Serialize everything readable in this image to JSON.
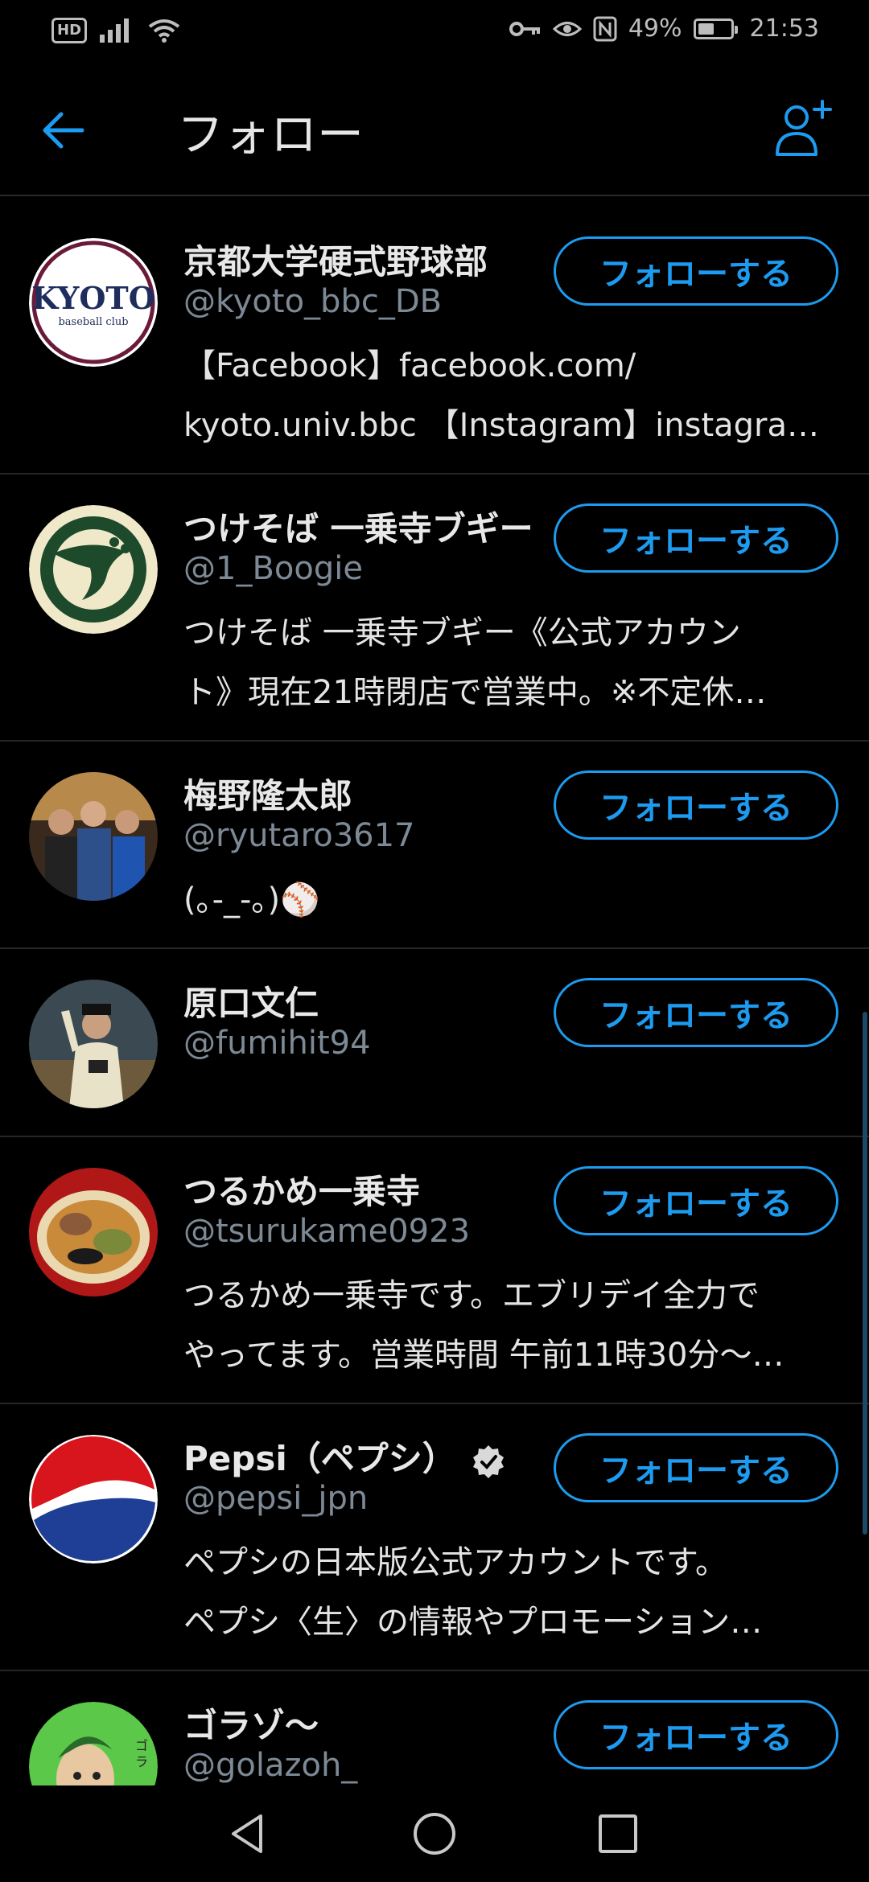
{
  "status_bar": {
    "hd": "HD",
    "battery": "49%",
    "battery_level": 0.49,
    "time": "21:53"
  },
  "header": {
    "title": "フォロー",
    "back_icon": "arrow-left-icon",
    "add_icon": "person-add-icon"
  },
  "accent_color": "#1d9bf0",
  "users": [
    {
      "name": "京都大学硬式野球部",
      "handle": "@kyoto_bbc_DB",
      "bio": [
        "【Facebook】facebook.com/",
        "kyoto.univ.bbc 【Instagram】instagra…"
      ],
      "follow": "フォローする",
      "avatar": {
        "type": "kyoto",
        "text": "KYOTO",
        "sub": "baseball club"
      }
    },
    {
      "name": "つけそば 一乗寺ブギー",
      "handle": "@1_Boogie",
      "bio": [
        "つけそば 一乗寺ブギー《公式アカウン",
        "ト》現在21時閉店で営業中。※不定休…"
      ],
      "follow": "フォローする",
      "avatar": {
        "type": "boogie"
      }
    },
    {
      "name": "梅野隆太郎",
      "handle": "@ryutaro3617",
      "bio": [
        "(｡-_-｡)⚾"
      ],
      "follow": "フォローする",
      "avatar": {
        "type": "photo1"
      }
    },
    {
      "name": "原口文仁",
      "handle": "@fumihit94",
      "bio": [],
      "follow": "フォローする",
      "avatar": {
        "type": "photo2"
      }
    },
    {
      "name": "つるかめ一乗寺",
      "handle": "@tsurukame0923",
      "bio": [
        "つるかめ一乗寺です。エブリデイ全力で",
        "やってます。営業時間 午前11時30分〜…"
      ],
      "follow": "フォローする",
      "avatar": {
        "type": "ramen"
      }
    },
    {
      "name": "Pepsi（ペプシ）",
      "handle": "@pepsi_jpn",
      "verified": true,
      "bio": [
        "ペプシの日本版公式アカウントです。",
        "ペプシ〈生〉の情報やプロモーション…"
      ],
      "follow": "フォローする",
      "avatar": {
        "type": "pepsi"
      }
    },
    {
      "name": "ゴラゾ〜",
      "handle": "@golazoh_",
      "bio": [],
      "follow": "フォローする",
      "avatar": {
        "type": "golazo"
      }
    }
  ],
  "nav": {
    "back": "triangle-back-icon",
    "home": "circle-home-icon",
    "recents": "square-recents-icon"
  }
}
